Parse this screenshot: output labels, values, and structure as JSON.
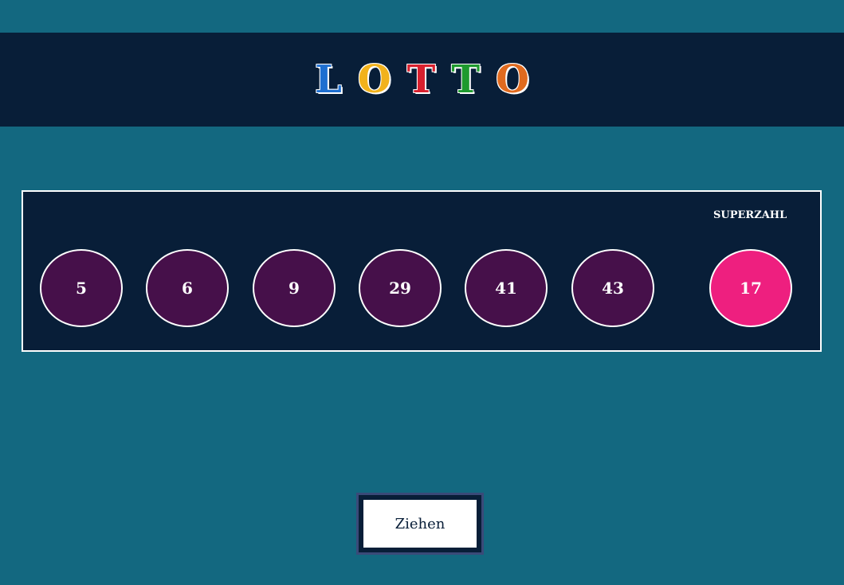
{
  "header": {
    "logo_letters": [
      {
        "char": "L",
        "color": "#1e6fd0"
      },
      {
        "char": "O",
        "color": "#f2b21c"
      },
      {
        "char": "T",
        "color": "#d8202e"
      },
      {
        "char": "T",
        "color": "#1e9a2e"
      },
      {
        "char": "O",
        "color": "#e06a1e"
      }
    ]
  },
  "draw": {
    "numbers": [
      "5",
      "6",
      "9",
      "29",
      "41",
      "43"
    ],
    "super_label": "SUPERZAHL",
    "super_number": "17"
  },
  "button": {
    "label": "Ziehen"
  },
  "colors": {
    "background": "#136880",
    "panel": "#081e38",
    "ball": "#46104a",
    "super_ball": "#ee1f7f"
  }
}
